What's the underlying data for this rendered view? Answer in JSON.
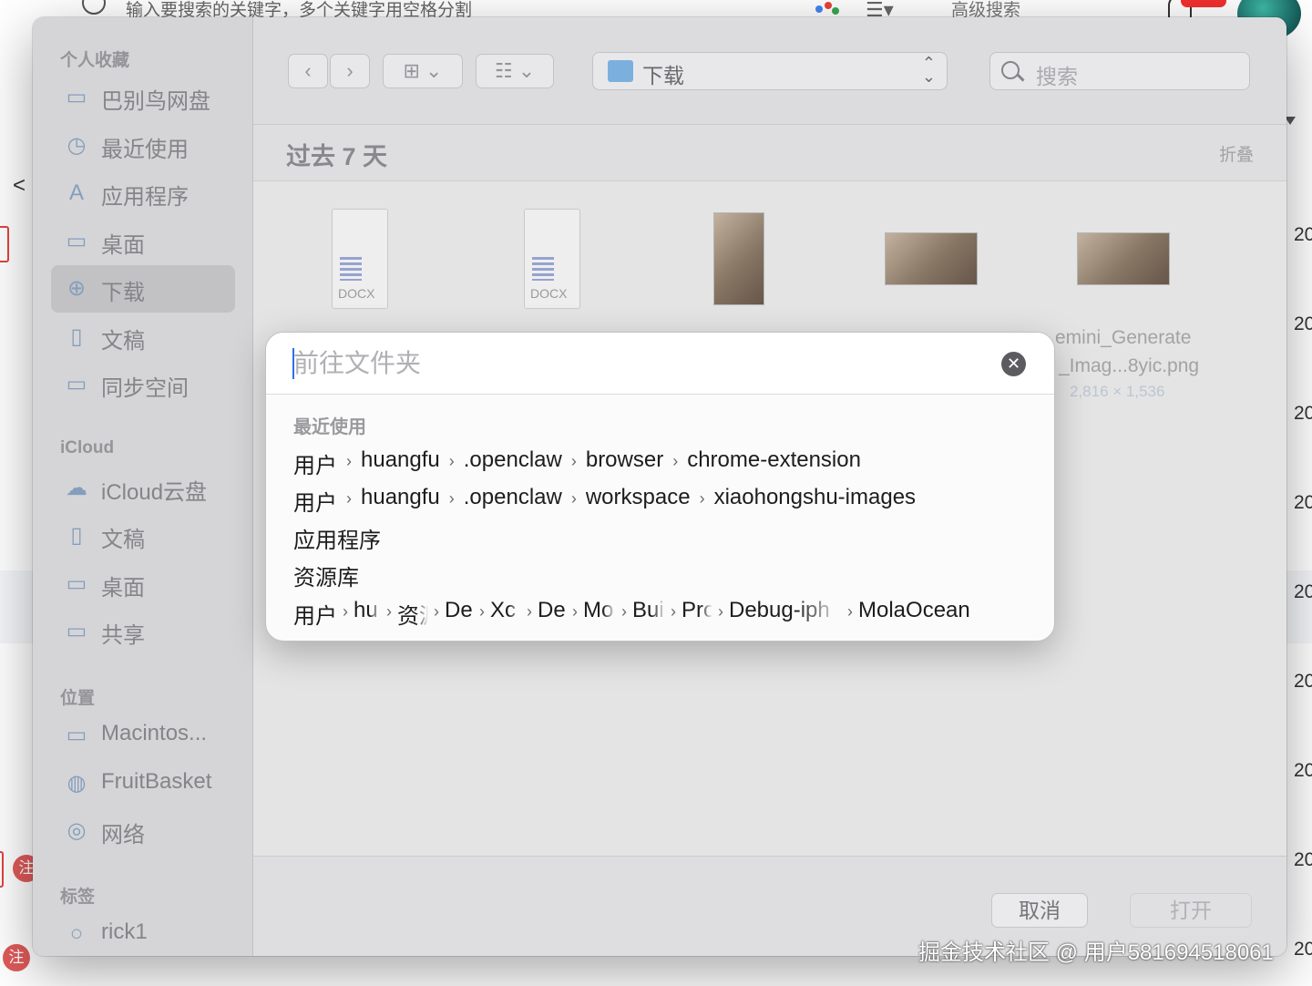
{
  "background_page": {
    "search_placeholder": "输入要搜索的关键字，多个关键字用空格分割",
    "advanced_search": "高级搜索",
    "side_numbers": [
      "20",
      "20",
      "20",
      "20",
      "20",
      "20",
      "20",
      "20",
      "20"
    ],
    "note_badge": "注"
  },
  "sidebar": {
    "favorites_header": "个人收藏",
    "favorites": [
      {
        "label": "巴别鸟网盘",
        "icon": "drive-icon"
      },
      {
        "label": "最近使用",
        "icon": "clock-icon"
      },
      {
        "label": "应用程序",
        "icon": "apps-icon"
      },
      {
        "label": "桌面",
        "icon": "desktop-icon"
      },
      {
        "label": "下载",
        "icon": "download-icon",
        "selected": true
      },
      {
        "label": "文稿",
        "icon": "document-icon"
      },
      {
        "label": "同步空间",
        "icon": "folder-icon"
      }
    ],
    "icloud_header": "iCloud",
    "icloud": [
      {
        "label": "iCloud云盘",
        "icon": "cloud-icon"
      },
      {
        "label": "文稿",
        "icon": "document-icon"
      },
      {
        "label": "桌面",
        "icon": "desktop-icon"
      },
      {
        "label": "共享",
        "icon": "shared-folder-icon"
      }
    ],
    "locations_header": "位置",
    "locations": [
      {
        "label": "Macintos...",
        "icon": "disk-icon"
      },
      {
        "label": "FruitBasket",
        "icon": "server-icon"
      },
      {
        "label": "网络",
        "icon": "globe-icon"
      }
    ],
    "tags_header": "标签",
    "tags": [
      {
        "label": "rick1",
        "icon": "tag-circle-icon"
      }
    ]
  },
  "toolbar": {
    "current_folder": "下载",
    "search_placeholder": "搜索"
  },
  "section": {
    "title": "过去 7 天",
    "fold_label": "折叠"
  },
  "files": {
    "doc_ext_1": "DOCX",
    "doc_ext_2": "DOCX",
    "visible_name_line1": "emini_Generate",
    "visible_name_line2": "_Imag...8yic.png",
    "visible_dims": "2,816 × 1,536"
  },
  "buttons": {
    "cancel": "取消",
    "open": "打开"
  },
  "goto_dialog": {
    "placeholder": "前往文件夹",
    "value": "",
    "recent_header": "最近使用",
    "recent_paths": [
      [
        "用户",
        "huangfu",
        ".openclaw",
        "browser",
        "chrome-extension"
      ],
      [
        "用户",
        "huangfu",
        ".openclaw",
        "workspace",
        "xiaohongshu-images"
      ],
      [
        "应用程序"
      ],
      [
        "资源库"
      ],
      [
        "用户",
        "hu",
        "资源",
        "De",
        "Xc",
        "De",
        "Mo",
        "Bui",
        "Pro",
        "Debug-iph",
        "MolaOcean"
      ]
    ]
  },
  "watermark": "掘金技术社区 @ 用户581694518061"
}
